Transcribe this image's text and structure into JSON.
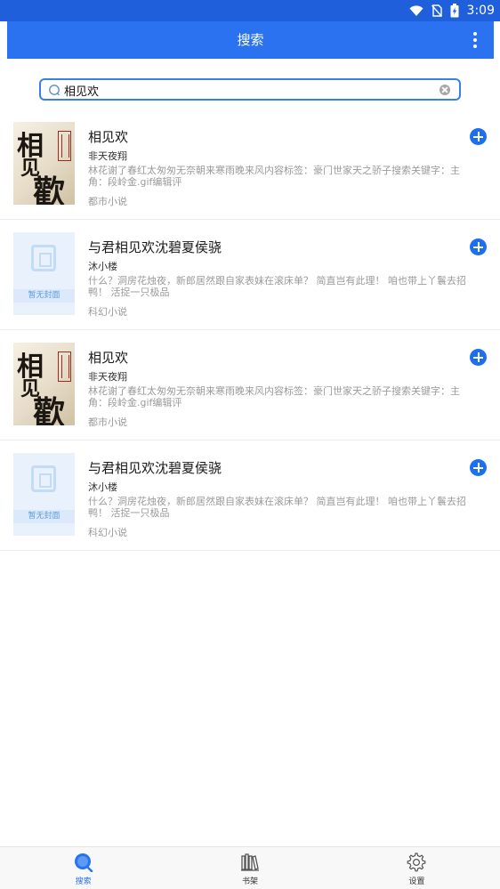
{
  "status_bar": {
    "time": "3:09"
  },
  "app_bar": {
    "title": "搜索"
  },
  "search": {
    "query": "相见欢"
  },
  "results": [
    {
      "title": "相见欢",
      "author": "非天夜翔",
      "description": "林花谢了春红太匆匆无奈朝来寒雨晚来风内容标签：豪门世家天之骄子搜索关键字：主角：段岭金.gif编辑评",
      "category": "都市小说",
      "cover": "art"
    },
    {
      "title": "与君相见欢沈碧夏侯骁",
      "author": "沐小楼",
      "description": " 什么？洞房花烛夜，新郎居然跟自家表妹在滚床单？ 简直岂有此理！ 咱也带上丫鬟去招鸭！ 活捉一只极品",
      "category": "科幻小说",
      "cover": "none",
      "cover_text": "暂无封面"
    },
    {
      "title": "相见欢",
      "author": "非天夜翔",
      "description": "林花谢了春红太匆匆无奈朝来寒雨晚来风内容标签：豪门世家天之骄子搜索关键字：主角：段岭金.gif编辑评",
      "category": "都市小说",
      "cover": "art"
    },
    {
      "title": "与君相见欢沈碧夏侯骁",
      "author": "沐小楼",
      "description": " 什么？洞房花烛夜，新郎居然跟自家表妹在滚床单？ 简直岂有此理！ 咱也带上丫鬟去招鸭！ 活捉一只极品",
      "category": "科幻小说",
      "cover": "none",
      "cover_text": "暂无封面"
    }
  ],
  "bottom_nav": [
    {
      "label": "搜索",
      "icon": "search-icon",
      "active": true
    },
    {
      "label": "书架",
      "icon": "bookshelf-icon",
      "active": false
    },
    {
      "label": "设置",
      "icon": "gear-icon",
      "active": false
    }
  ],
  "colors": {
    "primary": "#2a72ef",
    "status_bar": "#1f5fdc",
    "add_button": "#1c6ff0"
  }
}
